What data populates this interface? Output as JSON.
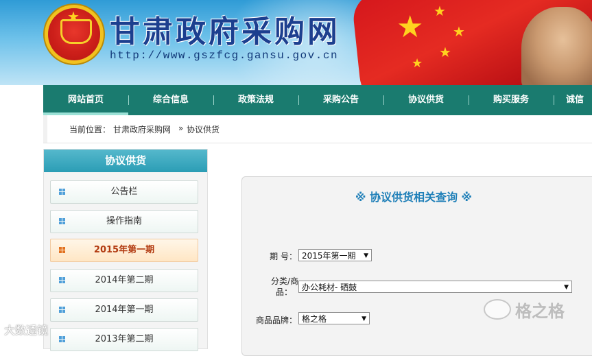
{
  "header": {
    "site_name": "甘肃政府采购网",
    "site_url": "http://www.gszfcg.gansu.gov.cn",
    "emblem_icon": "national-emblem-icon"
  },
  "nav": {
    "items": [
      {
        "label": "网站首页",
        "active": true
      },
      {
        "label": "综合信息"
      },
      {
        "label": "政策法规"
      },
      {
        "label": "采购公告"
      },
      {
        "label": "协议供货"
      },
      {
        "label": "购买服务"
      },
      {
        "label": "诚信"
      }
    ],
    "bg_color": "#1a7b6f"
  },
  "breadcrumb": {
    "prefix": "当前位置：",
    "home": "甘肃政府采购网",
    "separator": "»",
    "current": "协议供货"
  },
  "sidebar": {
    "title": "协议供货",
    "items": [
      {
        "label": "公告栏"
      },
      {
        "label": "操作指南"
      },
      {
        "label": "2015年第一期",
        "active": true
      },
      {
        "label": "2014年第二期"
      },
      {
        "label": "2014年第一期"
      },
      {
        "label": "2013年第二期"
      }
    ],
    "item_icon": "grid-icon"
  },
  "query": {
    "title": "※ 协议供货相关查询 ※",
    "period_label": "期 号：",
    "period_value": "2015年第一期",
    "category_label_line1": "分类/商",
    "category_label_line2": "品：",
    "category_value": "办公耗材- 硒鼓",
    "brand_label": "商品品牌：",
    "brand_value": "格之格"
  },
  "watermarks": {
    "right": "格之格",
    "left": "大数透镜"
  }
}
